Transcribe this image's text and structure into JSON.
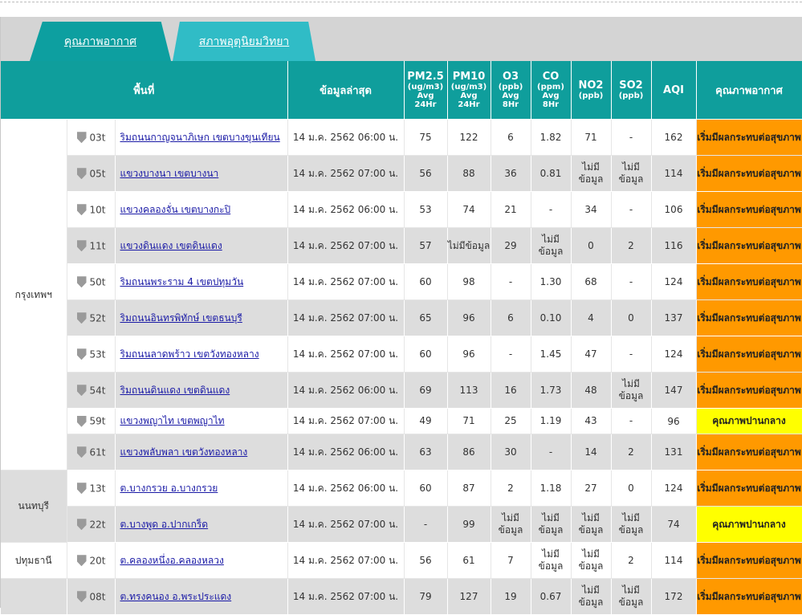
{
  "tabs": [
    {
      "label": "คุณภาพอากาศ"
    },
    {
      "label": "สภาพอุตุนิยมวิทยา"
    }
  ],
  "headers": {
    "area": "พื้นที่",
    "latest": "ข้อมูลล่าสุด",
    "pm25": {
      "name": "PM2.5",
      "unit": "(ug/m3)",
      "l1": "Avg",
      "l2": "24Hr"
    },
    "pm10": {
      "name": "PM10",
      "unit": "(ug/m3)",
      "l1": "Avg",
      "l2": "24Hr"
    },
    "o3": {
      "name": "O3",
      "unit": "(ppb)",
      "l1": "Avg",
      "l2": "8Hr"
    },
    "co": {
      "name": "CO",
      "unit": "(ppm)",
      "l1": "Avg",
      "l2": "8Hr"
    },
    "no2": {
      "name": "NO2",
      "unit": "(ppb)"
    },
    "so2": {
      "name": "SO2",
      "unit": "(ppb)"
    },
    "aqi": "AQI",
    "quality": "คุณภาพอากาศ"
  },
  "provinces": [
    "กรุงเทพฯ",
    "นนทบุรี",
    "ปทุมธานี"
  ],
  "rows": [
    {
      "id": "03t",
      "name": "ริมถนนกาญจนาภิเษก เขตบางขุนเทียน",
      "time": "14 ม.ค. 2562 06:00 น.",
      "pm25": "75",
      "pm10": "122",
      "o3": "6",
      "co": "1.82",
      "no2": "71",
      "so2": "-",
      "aqi": "162",
      "quality": "เริ่มมีผลกระทบต่อสุขภาพ",
      "level": "orange"
    },
    {
      "id": "05t",
      "name": "แขวงบางนา เขตบางนา",
      "time": "14 ม.ค. 2562 07:00 น.",
      "pm25": "56",
      "pm10": "88",
      "o3": "36",
      "co": "0.81",
      "no2": "ไม่มีข้อมูล",
      "so2": "ไม่มีข้อมูล",
      "aqi": "114",
      "quality": "เริ่มมีผลกระทบต่อสุขภาพ",
      "level": "orange"
    },
    {
      "id": "10t",
      "name": "แขวงคลองจั่น เขตบางกะปิ",
      "time": "14 ม.ค. 2562 06:00 น.",
      "pm25": "53",
      "pm10": "74",
      "o3": "21",
      "co": "-",
      "no2": "34",
      "so2": "-",
      "aqi": "106",
      "quality": "เริ่มมีผลกระทบต่อสุขภาพ",
      "level": "orange"
    },
    {
      "id": "11t",
      "name": "แขวงดินแดง เขตดินแดง",
      "time": "14 ม.ค. 2562 07:00 น.",
      "pm25": "57",
      "pm10": "ไม่มีข้อมูล",
      "o3": "29",
      "co": "ไม่มีข้อมูล",
      "no2": "0",
      "so2": "2",
      "aqi": "116",
      "quality": "เริ่มมีผลกระทบต่อสุขภาพ",
      "level": "orange"
    },
    {
      "id": "50t",
      "name": "ริมถนนพระราม 4 เขตปทุมวัน",
      "time": "14 ม.ค. 2562 07:00 น.",
      "pm25": "60",
      "pm10": "98",
      "o3": "-",
      "co": "1.30",
      "no2": "68",
      "so2": "-",
      "aqi": "124",
      "quality": "เริ่มมีผลกระทบต่อสุขภาพ",
      "level": "orange"
    },
    {
      "id": "52t",
      "name": "ริมถนนอินทรพิทักษ์ เขตธนบุรี",
      "time": "14 ม.ค. 2562 07:00 น.",
      "pm25": "65",
      "pm10": "96",
      "o3": "6",
      "co": "0.10",
      "no2": "4",
      "so2": "0",
      "aqi": "137",
      "quality": "เริ่มมีผลกระทบต่อสุขภาพ",
      "level": "orange"
    },
    {
      "id": "53t",
      "name": "ริมถนนลาดพร้าว เขตวังทองหลาง",
      "time": "14 ม.ค. 2562 07:00 น.",
      "pm25": "60",
      "pm10": "96",
      "o3": "-",
      "co": "1.45",
      "no2": "47",
      "so2": "-",
      "aqi": "124",
      "quality": "เริ่มมีผลกระทบต่อสุขภาพ",
      "level": "orange"
    },
    {
      "id": "54t",
      "name": "ริมถนนดินแดง เขตดินแดง",
      "time": "14 ม.ค. 2562 06:00 น.",
      "pm25": "69",
      "pm10": "113",
      "o3": "16",
      "co": "1.73",
      "no2": "48",
      "so2": "ไม่มีข้อมูล",
      "aqi": "147",
      "quality": "เริ่มมีผลกระทบต่อสุขภาพ",
      "level": "orange"
    },
    {
      "id": "59t",
      "name": "แขวงพญาไท เขตพญาไท",
      "time": "14 ม.ค. 2562 07:00 น.",
      "pm25": "49",
      "pm10": "71",
      "o3": "25",
      "co": "1.19",
      "no2": "43",
      "so2": "-",
      "aqi": "96",
      "quality": "คุณภาพปานกลาง",
      "level": "yellow"
    },
    {
      "id": "61t",
      "name": "แขวงพลับพลา เขตวังทองหลาง",
      "time": "14 ม.ค. 2562 06:00 น.",
      "pm25": "63",
      "pm10": "86",
      "o3": "30",
      "co": "-",
      "no2": "14",
      "so2": "2",
      "aqi": "131",
      "quality": "เริ่มมีผลกระทบต่อสุขภาพ",
      "level": "orange"
    },
    {
      "id": "13t",
      "name": "ต.บางกรวย อ.บางกรวย",
      "time": "14 ม.ค. 2562 06:00 น.",
      "pm25": "60",
      "pm10": "87",
      "o3": "2",
      "co": "1.18",
      "no2": "27",
      "so2": "0",
      "aqi": "124",
      "quality": "เริ่มมีผลกระทบต่อสุขภาพ",
      "level": "orange"
    },
    {
      "id": "22t",
      "name": "ต.บางพูด อ.ปากเกร็ด",
      "time": "14 ม.ค. 2562 07:00 น.",
      "pm25": "-",
      "pm10": "99",
      "o3": "ไม่มีข้อมูล",
      "co": "ไม่มีข้อมูล",
      "no2": "ไม่มีข้อมูล",
      "so2": "ไม่มีข้อมูล",
      "aqi": "74",
      "quality": "คุณภาพปานกลาง",
      "level": "yellow"
    },
    {
      "id": "20t",
      "name": "ต.คลองหนึ่งอ.คลองหลวง",
      "time": "14 ม.ค. 2562 07:00 น.",
      "pm25": "56",
      "pm10": "61",
      "o3": "7",
      "co": "ไม่มีข้อมูล",
      "no2": "ไม่มีข้อมูล",
      "so2": "2",
      "aqi": "114",
      "quality": "เริ่มมีผลกระทบต่อสุขภาพ",
      "level": "orange"
    },
    {
      "id": "08t",
      "name": "ต.ทรงคนอง อ.พระประแดง",
      "time": "14 ม.ค. 2562 07:00 น.",
      "pm25": "79",
      "pm10": "127",
      "o3": "19",
      "co": "0.67",
      "no2": "ไม่มีข้อมูล",
      "so2": "ไม่มีข้อมูล",
      "aqi": "172",
      "quality": "เริ่มมีผลกระทบต่อสุขภาพ",
      "level": "orange"
    }
  ]
}
